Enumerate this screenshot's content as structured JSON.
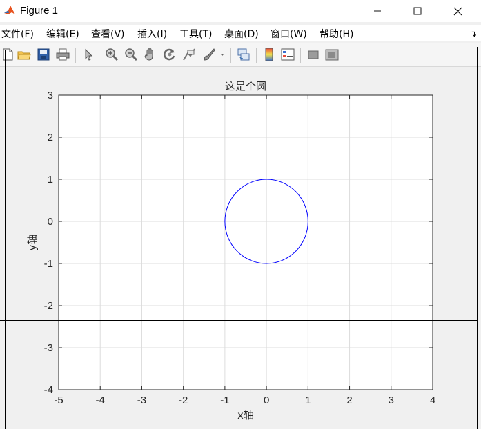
{
  "window": {
    "title": "Figure 1",
    "accent": "#e8531f"
  },
  "menu": [
    {
      "label": "文件(F)"
    },
    {
      "label": "编辑(E)"
    },
    {
      "label": "查看(V)"
    },
    {
      "label": "插入(I)"
    },
    {
      "label": "工具(T)"
    },
    {
      "label": "桌面(D)"
    },
    {
      "label": "窗口(W)"
    },
    {
      "label": "帮助(H)"
    }
  ],
  "toolbar": [
    {
      "icon": "new-figure-icon"
    },
    {
      "icon": "open-file-icon"
    },
    {
      "icon": "save-icon"
    },
    {
      "icon": "print-icon"
    },
    {
      "icon": "edit-plot-arrow-icon"
    },
    {
      "icon": "zoom-in-icon"
    },
    {
      "icon": "zoom-out-icon"
    },
    {
      "icon": "pan-hand-icon"
    },
    {
      "icon": "rotate-3d-icon"
    },
    {
      "icon": "data-cursor-icon"
    },
    {
      "icon": "brush-icon"
    },
    {
      "icon": "link-plot-icon"
    },
    {
      "icon": "colorbar-icon"
    },
    {
      "icon": "legend-icon"
    },
    {
      "icon": "hide-plot-tools-icon"
    },
    {
      "icon": "show-plot-tools-icon"
    }
  ],
  "chart_data": {
    "type": "line",
    "title": "这是个圆",
    "xlabel": "x轴",
    "ylabel": "y轴",
    "xlim": [
      -5,
      4
    ],
    "ylim": [
      -4,
      3
    ],
    "xticks": [
      -5,
      -4,
      -3,
      -2,
      -1,
      0,
      1,
      2,
      3,
      4
    ],
    "yticks": [
      -4,
      -3,
      -2,
      -1,
      0,
      1,
      2,
      3
    ],
    "grid": true,
    "series": [
      {
        "shape": "circle",
        "center": [
          0,
          0
        ],
        "radius": 1,
        "color": "#0000ff"
      }
    ]
  }
}
